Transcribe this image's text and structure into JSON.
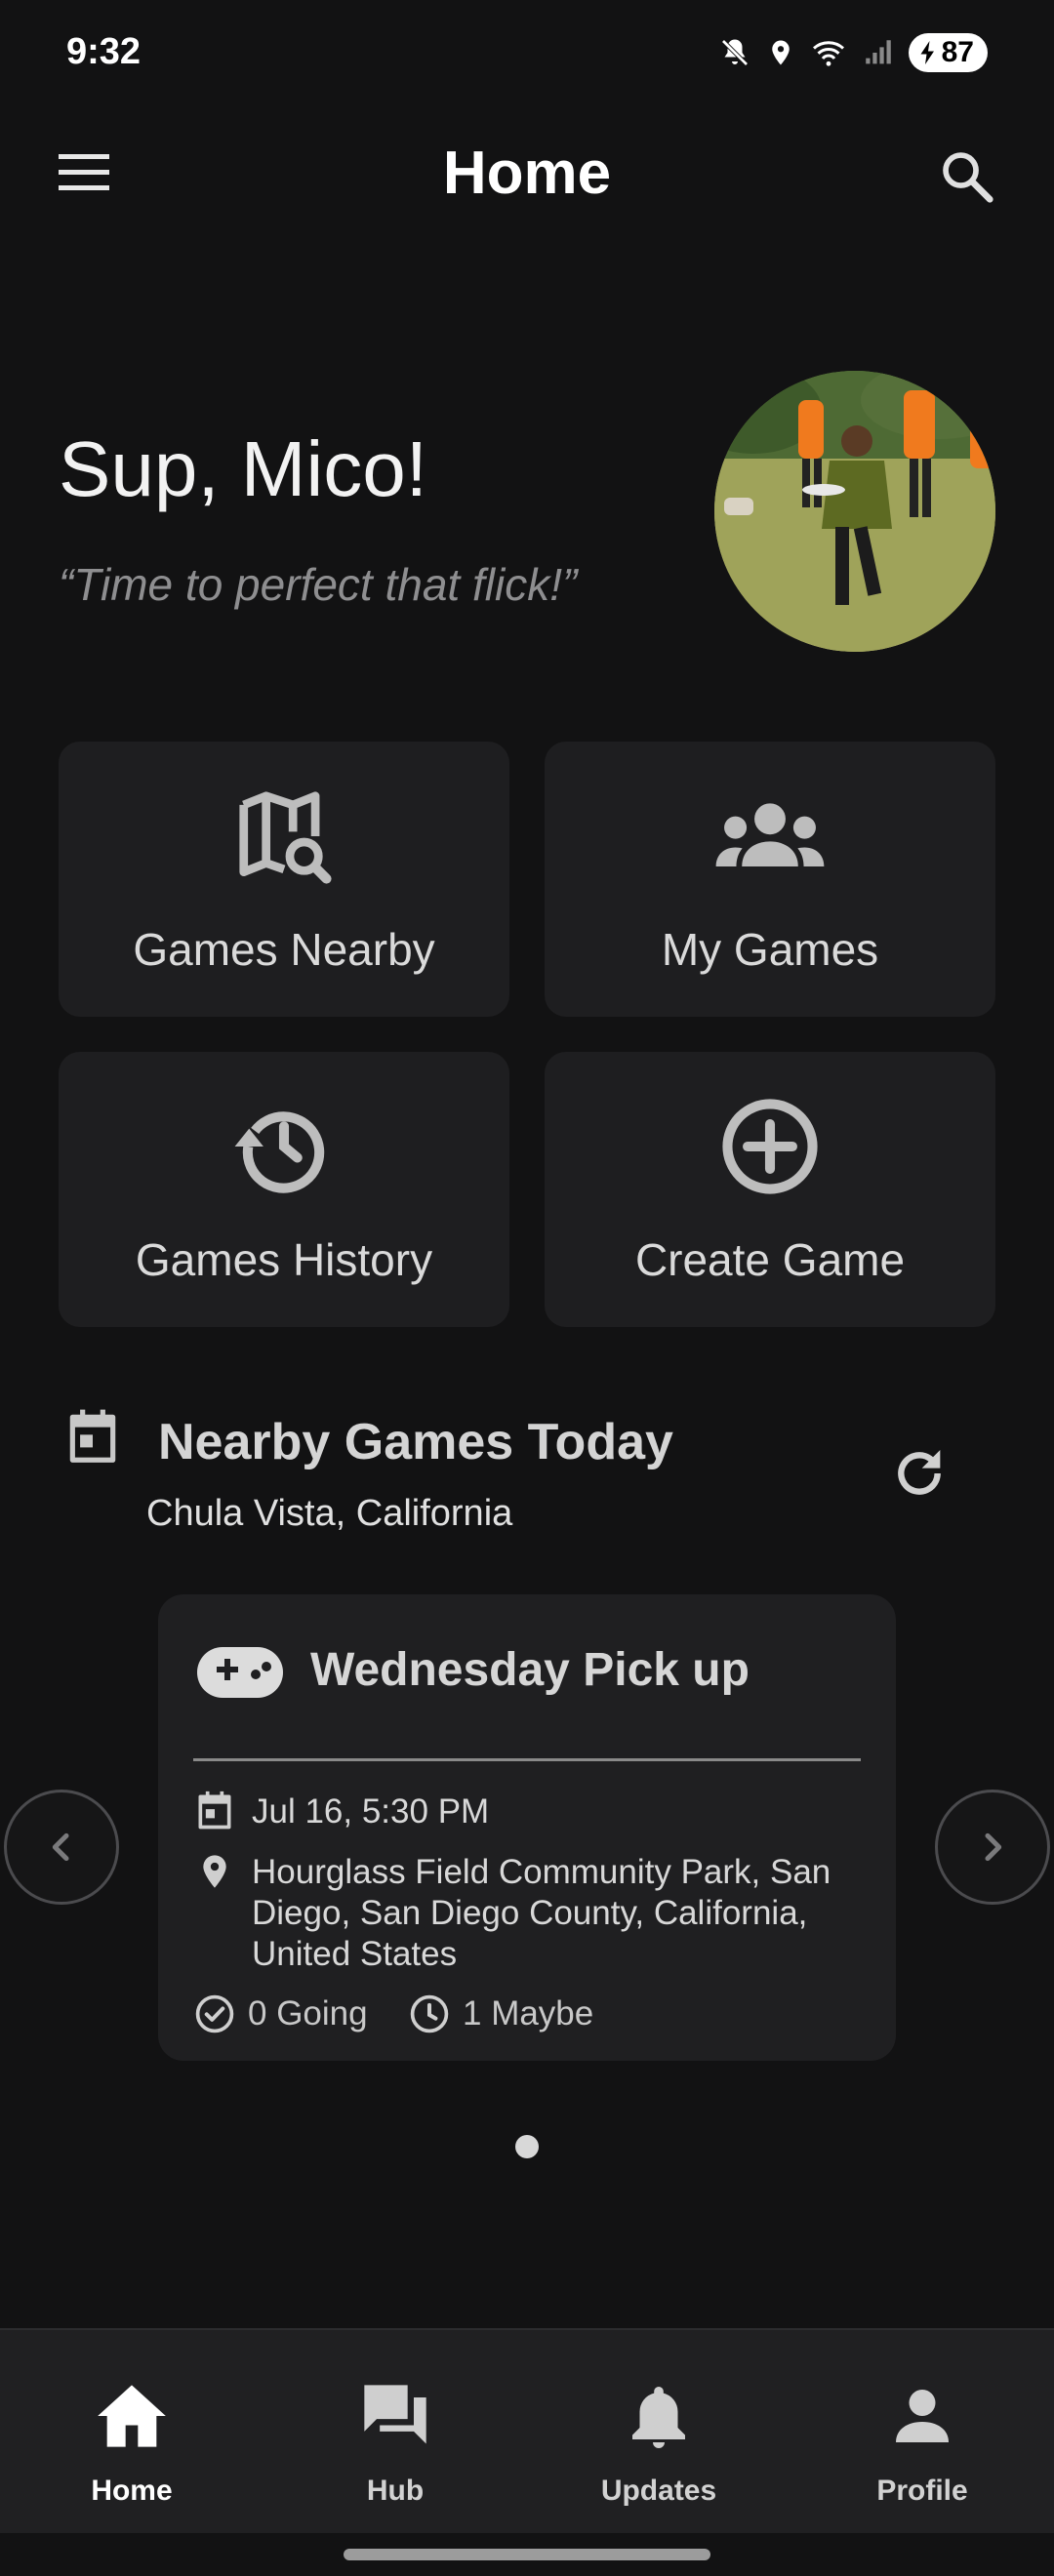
{
  "status_bar": {
    "time": "9:32",
    "battery": "87",
    "icons": [
      "mute-icon",
      "location-icon",
      "wifi-icon",
      "signal-icon",
      "battery-icon"
    ]
  },
  "app_bar": {
    "title": "Home",
    "menu_icon": "hamburger-menu-icon",
    "search_icon": "search-icon"
  },
  "greeting": {
    "text": "Sup, Mico!",
    "quote": "“Time to perfect that flick!”"
  },
  "tiles": [
    {
      "label": "Games Nearby",
      "icon": "map-search-icon"
    },
    {
      "label": "My Games",
      "icon": "groups-icon"
    },
    {
      "label": "Games History",
      "icon": "history-icon"
    },
    {
      "label": "Create Game",
      "icon": "add-circle-icon"
    }
  ],
  "nearby": {
    "title": "Nearby Games Today",
    "location": "Chula Vista, California",
    "games": [
      {
        "name": "Wednesday Pick up",
        "datetime": "Jul 16, 5:30 PM",
        "address": [
          "Hourglass Field Community Park, San",
          "Diego, San Diego County, California,",
          "United States"
        ],
        "going": "0 Going",
        "maybe": "1 Maybe"
      }
    ],
    "carousel_page": 1,
    "carousel_total": 1
  },
  "bottom_nav": {
    "items": [
      {
        "label": "Home",
        "icon": "home-icon",
        "active": true
      },
      {
        "label": "Hub",
        "icon": "forum-icon",
        "active": false
      },
      {
        "label": "Updates",
        "icon": "bell-icon",
        "active": false
      },
      {
        "label": "Profile",
        "icon": "person-icon",
        "active": false
      }
    ]
  },
  "colors": {
    "background": "#121213",
    "surface": "#1e1e20",
    "text_primary": "#ffffff",
    "text_muted": "#8e8e90",
    "icon": "#c8c8c8"
  }
}
